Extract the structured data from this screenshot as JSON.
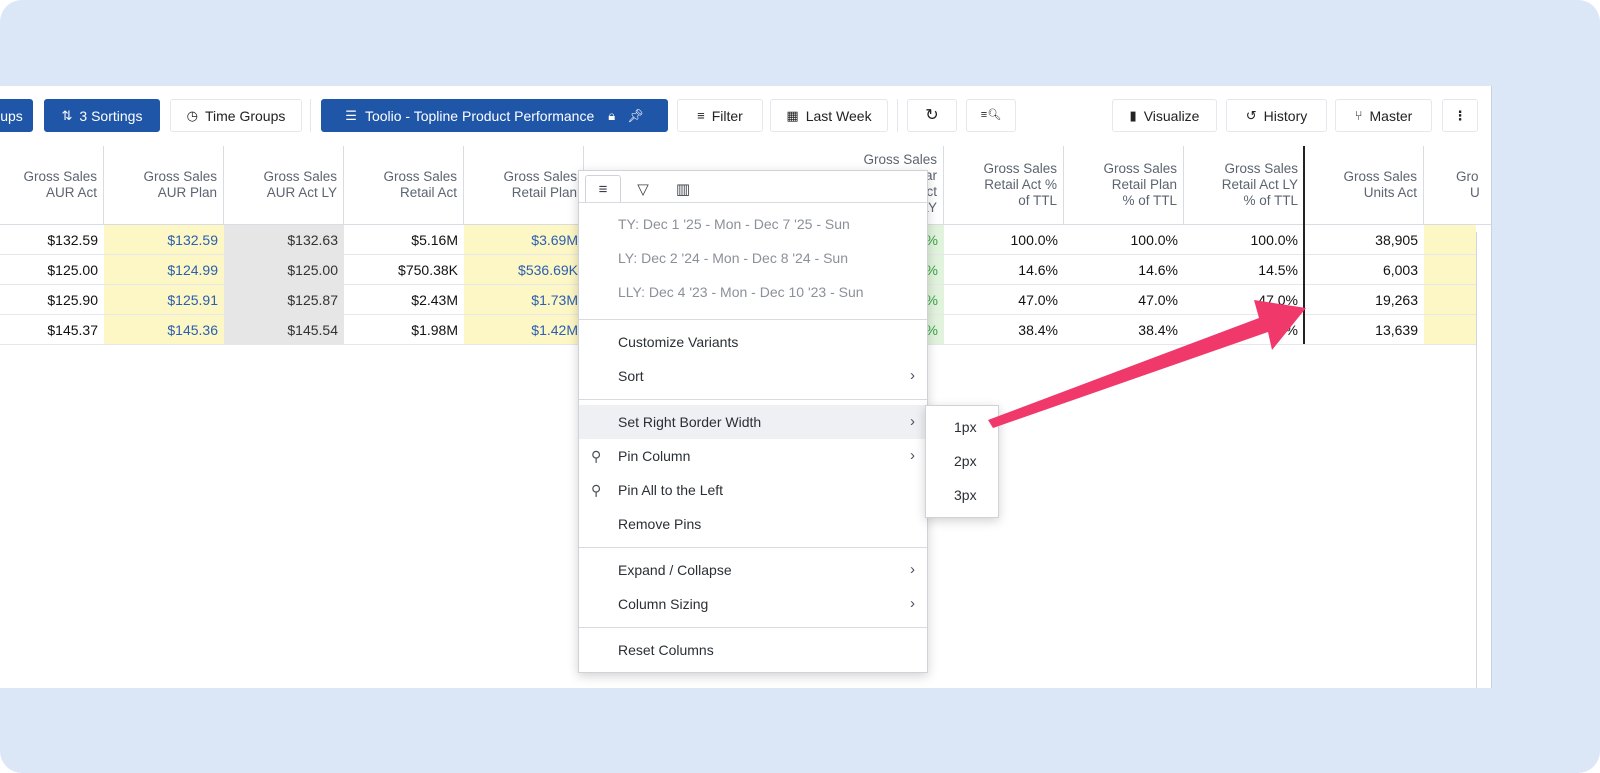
{
  "toolbar": {
    "groups_partial": "ups",
    "sortings": "3 Sortings",
    "time_groups": "Time Groups",
    "view_name": "Toolio - Topline Product Performance",
    "filter": "Filter",
    "last_week": "Last Week",
    "visualize": "Visualize",
    "history": "History",
    "master": "Master"
  },
  "columns": [
    {
      "l1": "Gross Sales",
      "l2": "AUR Act",
      "l3": ""
    },
    {
      "l1": "Gross Sales",
      "l2": "AUR Plan",
      "l3": ""
    },
    {
      "l1": "Gross Sales",
      "l2": "AUR Act LY",
      "l3": ""
    },
    {
      "l1": "Gross Sales",
      "l2": "Retail Act",
      "l3": ""
    },
    {
      "l1": "Gross Sales",
      "l2": "Retail Plan",
      "l3": ""
    },
    {
      "l1": "Gross Sales",
      "l2": "Retail Act %",
      "l3": "of TTL"
    },
    {
      "l1": "Gross Sales",
      "l2": "Retail Plan",
      "l3": "% of TTL"
    },
    {
      "l1": "Gross Sales",
      "l2": "Retail Act LY",
      "l3": "% of TTL"
    },
    {
      "l1": "Gross Sales",
      "l2": "Units Act",
      "l3": ""
    },
    {
      "l1": "Gro",
      "l2": "U",
      "l3": ""
    }
  ],
  "hidden_col_header": {
    "l1": "Gross Sales",
    "l2": "ar",
    "l3": "ct",
    "l4": "LY"
  },
  "rows": [
    [
      "$132.59",
      "$132.59",
      "$132.63",
      "$5.16M",
      "$3.69M",
      "%",
      "100.0%",
      "100.0%",
      "100.0%",
      "38,905"
    ],
    [
      "$125.00",
      "$124.99",
      "$125.00",
      "$750.38K",
      "$536.69K",
      "%",
      "14.6%",
      "14.6%",
      "14.5%",
      "6,003"
    ],
    [
      "$125.90",
      "$125.91",
      "$125.87",
      "$2.43M",
      "$1.73M",
      "%",
      "47.0%",
      "47.0%",
      "47.0%",
      "19,263"
    ],
    [
      "$145.37",
      "$145.36",
      "$145.54",
      "$1.98M",
      "$1.42M",
      "%",
      "38.4%",
      "38.4%",
      "%",
      "13,639"
    ]
  ],
  "menu": {
    "ty": "TY: Dec 1 '25 - Mon - Dec 7 '25 - Sun",
    "ly": "LY: Dec 2 '24 - Mon - Dec 8 '24 - Sun",
    "lly": "LLY: Dec 4 '23 - Mon - Dec 10 '23 - Sun",
    "customize_variants": "Customize Variants",
    "sort": "Sort",
    "set_right_border_width": "Set Right Border Width",
    "pin_column": "Pin Column",
    "pin_all_left": "Pin All to the Left",
    "remove_pins": "Remove Pins",
    "expand_collapse": "Expand / Collapse",
    "column_sizing": "Column Sizing",
    "reset_columns": "Reset Columns"
  },
  "submenu": {
    "opt1": "1px",
    "opt2": "2px",
    "opt3": "3px"
  },
  "colors": {
    "primary": "#1f56a8",
    "plan_bg": "#fdf6c5",
    "plan_text": "#2b5fb0",
    "ly_bg": "#e6e6e6",
    "arrow": "#f0386b",
    "frame_bg": "#dbe7f7"
  }
}
